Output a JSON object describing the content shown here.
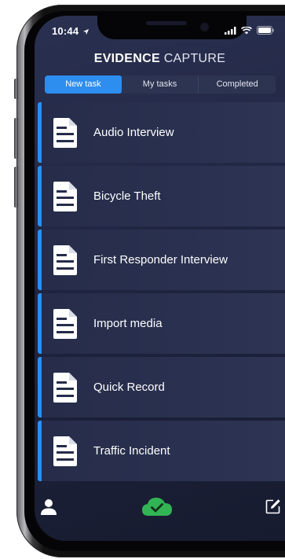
{
  "status_bar": {
    "time": "10:44"
  },
  "header": {
    "title_bold": "EVIDENCE",
    "title_light": "CAPTURE"
  },
  "tabs": [
    {
      "label": "New task",
      "active": true
    },
    {
      "label": "My tasks",
      "active": false
    },
    {
      "label": "Completed",
      "active": false
    }
  ],
  "tasks": [
    {
      "label": "Audio Interview",
      "icon": "document-icon"
    },
    {
      "label": "Bicycle Theft",
      "icon": "document-icon"
    },
    {
      "label": "First Responder Interview",
      "icon": "document-icon"
    },
    {
      "label": "Import media",
      "icon": "document-icon"
    },
    {
      "label": "Quick Record",
      "icon": "document-icon"
    },
    {
      "label": "Traffic Incident",
      "icon": "document-icon"
    }
  ],
  "bottom_nav": [
    {
      "icon": "user-icon"
    },
    {
      "icon": "cloud-check-icon"
    },
    {
      "icon": "edit-icon"
    }
  ],
  "colors": {
    "accent": "#2d8ef0",
    "background": "#1f2541",
    "card": "#2a3150",
    "sync_ok": "#32b455"
  }
}
